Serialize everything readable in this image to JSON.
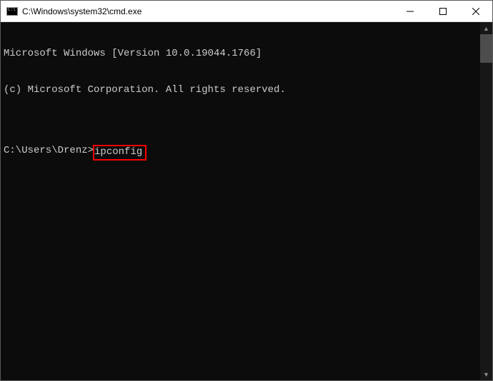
{
  "window": {
    "title": "C:\\Windows\\system32\\cmd.exe"
  },
  "terminal": {
    "line1": "Microsoft Windows [Version 10.0.19044.1766]",
    "line2": "(c) Microsoft Corporation. All rights reserved.",
    "blank": "",
    "prompt": "C:\\Users\\Drenz>",
    "command": "ipconfig"
  }
}
